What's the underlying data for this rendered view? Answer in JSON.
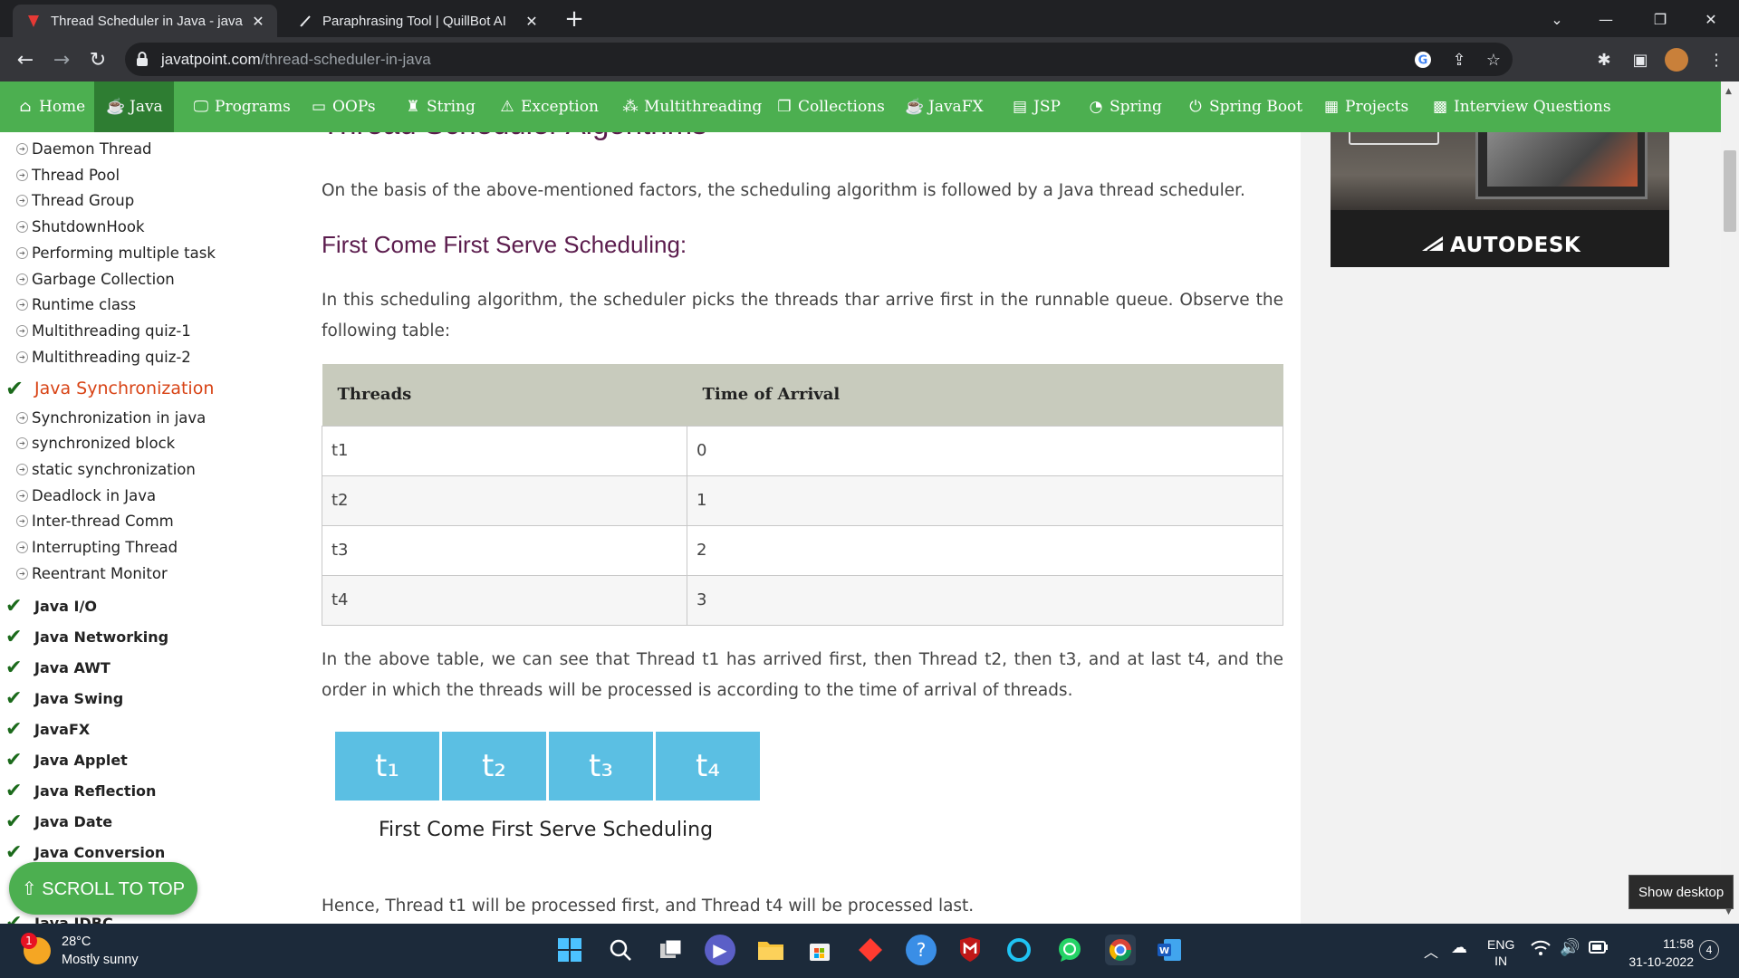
{
  "browser": {
    "tabs": [
      {
        "title": "Thread Scheduler in Java - javatp",
        "active": true,
        "favicon": "javatpoint-icon"
      },
      {
        "title": "Paraphrasing Tool | QuillBot AI",
        "active": false,
        "favicon": "quillbot-icon"
      }
    ],
    "url_host": "javatpoint.com",
    "url_path": "/thread-scheduler-in-java"
  },
  "site_nav": {
    "items": [
      {
        "label": "Home",
        "icon": "home-icon"
      },
      {
        "label": "Java",
        "icon": "java-icon",
        "active": true
      },
      {
        "label": "Programs",
        "icon": "monitor-icon"
      },
      {
        "label": "OOPs",
        "icon": "window-icon"
      },
      {
        "label": "String",
        "icon": "string-icon"
      },
      {
        "label": "Exception",
        "icon": "warning-icon"
      },
      {
        "label": "Multithreading",
        "icon": "threads-icon"
      },
      {
        "label": "Collections",
        "icon": "collections-icon"
      },
      {
        "label": "JavaFX",
        "icon": "javafx-icon"
      },
      {
        "label": "JSP",
        "icon": "jsp-icon"
      },
      {
        "label": "Spring",
        "icon": "spring-icon"
      },
      {
        "label": "Spring Boot",
        "icon": "power-icon"
      },
      {
        "label": "Projects",
        "icon": "projects-icon"
      },
      {
        "label": "Interview Questions",
        "icon": "interview-icon"
      }
    ]
  },
  "sidebar": {
    "multithreading_items": [
      "Daemon Thread",
      "Thread Pool",
      "Thread Group",
      "ShutdownHook",
      "Performing multiple task",
      "Garbage Collection",
      "Runtime class",
      "Multithreading quiz-1",
      "Multithreading quiz-2"
    ],
    "open_category": "Java Synchronization",
    "sync_items": [
      "Synchronization in java",
      "synchronized block",
      "static synchronization",
      "Deadlock in Java",
      "Inter-thread Comm",
      "Interrupting Thread",
      "Reentrant Monitor"
    ],
    "categories": [
      "Java I/O",
      "Java Networking",
      "Java AWT",
      "Java Swing",
      "JavaFX",
      "Java Applet",
      "Java Reflection",
      "Java Date",
      "Java Conversion",
      "Java JDBC"
    ]
  },
  "article": {
    "partial_heading": "Thread Scheduler Algorithms",
    "intro": "On the basis of the above-mentioned factors, the scheduling algorithm is followed by a Java thread scheduler.",
    "fcfs_heading": "First Come First Serve Scheduling:",
    "fcfs_desc": "In this scheduling algorithm, the scheduler picks the threads thar arrive first in the runnable queue. Observe the following table:",
    "table": {
      "headers": [
        "Threads",
        "Time of Arrival"
      ],
      "rows": [
        [
          "t1",
          "0"
        ],
        [
          "t2",
          "1"
        ],
        [
          "t3",
          "2"
        ],
        [
          "t4",
          "3"
        ]
      ]
    },
    "after_table": "In the above table, we can see that Thread t1 has arrived first, then Thread t2, then t3, and at last t4, and the order in which the threads will be processed is according to the time of arrival of threads.",
    "figure": {
      "boxes": [
        "t₁",
        "t₂",
        "t₃",
        "t₄"
      ],
      "caption": "First Come First Serve Scheduling"
    },
    "conclusion": "Hence, Thread t1 will be processed first, and Thread t4 will be processed last."
  },
  "ad": {
    "brand": "AUTODESK"
  },
  "scroll_top": "⇧ SCROLL TO TOP",
  "tooltip": "Show desktop",
  "taskbar": {
    "weather_temp": "28°C",
    "weather_desc": "Mostly sunny",
    "weather_badge": "1",
    "lang_line1": "ENG",
    "lang_line2": "IN",
    "time": "11:58",
    "date": "31-10-2022",
    "notif_count": "4"
  }
}
